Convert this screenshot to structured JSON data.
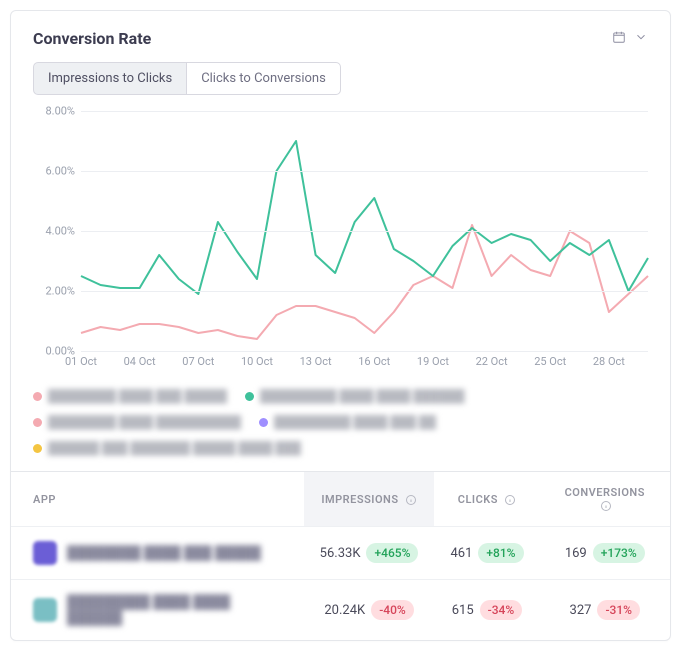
{
  "title": "Conversion Rate",
  "tabs": {
    "impressions": "Impressions to Clicks",
    "conversions": "Clicks to Conversions"
  },
  "chart_data": {
    "type": "line",
    "xlabel": "",
    "ylabel": "",
    "ylim": [
      0,
      8
    ],
    "y_ticks": [
      0,
      2,
      4,
      6,
      8
    ],
    "y_tick_labels": [
      "0.00%",
      "2.00%",
      "4.00%",
      "6.00%",
      "8.00%"
    ],
    "x_tick_indices": [
      0,
      3,
      6,
      9,
      12,
      15,
      18,
      21,
      24,
      27
    ],
    "x_tick_labels": [
      "01 Oct",
      "04 Oct",
      "07 Oct",
      "10 Oct",
      "13 Oct",
      "16 Oct",
      "19 Oct",
      "22 Oct",
      "25 Oct",
      "28 Oct"
    ],
    "categories": [
      "01 Oct",
      "02 Oct",
      "03 Oct",
      "04 Oct",
      "05 Oct",
      "06 Oct",
      "07 Oct",
      "08 Oct",
      "09 Oct",
      "10 Oct",
      "11 Oct",
      "12 Oct",
      "13 Oct",
      "14 Oct",
      "15 Oct",
      "16 Oct",
      "17 Oct",
      "18 Oct",
      "19 Oct",
      "20 Oct",
      "21 Oct",
      "22 Oct",
      "23 Oct",
      "24 Oct",
      "25 Oct",
      "26 Oct",
      "27 Oct",
      "28 Oct",
      "29 Oct",
      "30 Oct"
    ],
    "series": [
      {
        "name": "series-pink",
        "color": "#f4aab1",
        "values": [
          0.6,
          0.8,
          0.7,
          0.9,
          0.9,
          0.8,
          0.6,
          0.7,
          0.5,
          0.4,
          1.2,
          1.5,
          1.5,
          1.3,
          1.1,
          0.6,
          1.3,
          2.2,
          2.5,
          2.1,
          4.2,
          2.5,
          3.2,
          2.7,
          2.5,
          4.0,
          3.6,
          1.3,
          1.9,
          2.5
        ]
      },
      {
        "name": "series-green",
        "color": "#3fc19b",
        "values": [
          2.5,
          2.2,
          2.1,
          2.1,
          3.2,
          2.4,
          1.9,
          4.3,
          3.3,
          2.4,
          6.0,
          7.0,
          3.2,
          2.6,
          4.3,
          5.1,
          3.4,
          3.0,
          2.5,
          3.5,
          4.1,
          3.6,
          3.9,
          3.7,
          3.0,
          3.6,
          3.2,
          3.7,
          2.0,
          3.1
        ]
      }
    ]
  },
  "legend": [
    {
      "color": "#f4aab1",
      "label": "████████ ████ ███ █████"
    },
    {
      "color": "#3fc19b",
      "label": "█████████ ████ ████ ██████"
    },
    {
      "color": "#f4aab1",
      "label": "████████ ████ ██████████"
    },
    {
      "color": "#9f8fff",
      "label": "█████████ ████ ███ ██"
    },
    {
      "color": "#f4c542",
      "label": "██████ ███ ███████ █████ ████ ███"
    }
  ],
  "table": {
    "headers": {
      "app": "APP",
      "impressions": "IMPRESSIONS",
      "clicks": "CLICKS",
      "conversions": "CONVERSIONS"
    },
    "rows": [
      {
        "icon_color": "#6b5ed6",
        "name": "████████ ████ ███ █████",
        "impressions": {
          "value": "56.33K",
          "delta": "+465%",
          "dir": "pos"
        },
        "clicks": {
          "value": "461",
          "delta": "+81%",
          "dir": "pos"
        },
        "conversions": {
          "value": "169",
          "delta": "+173%",
          "dir": "pos"
        }
      },
      {
        "icon_color": "#7abfc4",
        "name": "█████████ ████ ████ ██████",
        "impressions": {
          "value": "20.24K",
          "delta": "-40%",
          "dir": "neg"
        },
        "clicks": {
          "value": "615",
          "delta": "-34%",
          "dir": "neg"
        },
        "conversions": {
          "value": "327",
          "delta": "-31%",
          "dir": "neg"
        }
      }
    ]
  }
}
